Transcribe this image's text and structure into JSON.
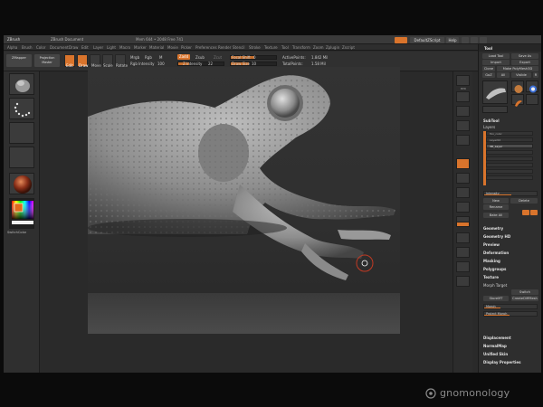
{
  "titlebar": {
    "app": "ZBrush",
    "doc": "ZBrush Document",
    "stats": "Mem 644 • 2048  Free 741",
    "default_zscript": "DefaultZScript",
    "help": "Help"
  },
  "menu": [
    "Alpha",
    "Brush",
    "Color",
    "Document",
    "Draw",
    "Edit",
    "Layer",
    "Light",
    "Macro",
    "Marker",
    "Material",
    "Movie",
    "Picker",
    "Preferences",
    "Render",
    "Stencil",
    "Stroke",
    "Texture",
    "Tool",
    "Transform",
    "Zoom",
    "Zplugin",
    "Zscript"
  ],
  "toolbar": {
    "zappend_label": "ZMapper",
    "projection_label": "Projection Master",
    "edit_label": "Edit",
    "draw_label": "Draw",
    "move_label": "Move",
    "scale_label": "Scale",
    "rotate_label": "Rotate",
    "mrgb_label": "Mrgb",
    "rgb_label": "Rgb",
    "m_label": "M",
    "rgb_intensity_label": "Rgb Intensity",
    "rgb_intensity_value": "100",
    "zadd_label": "Zadd",
    "zsub_label": "Zsub",
    "zcut_label": "Zcut",
    "z_intensity_label": "Z Intensity",
    "z_intensity_value": "22",
    "focal_shift_label": "Focal Shift",
    "focal_shift_value": "0",
    "draw_size_label": "Draw Size",
    "draw_size_value": "10",
    "active_points_label": "ActivePoints:",
    "active_points_value": "1.842 Mil",
    "total_points_label": "TotalPoints:",
    "total_points_value": "1.58 Mil"
  },
  "left_shelf": {
    "texture_label": "Texture",
    "material_label": "Material",
    "switch_color_label": "SwitchColor"
  },
  "right_shelf": {
    "items": [
      "BPR",
      "SPix",
      "Scroll",
      "Zoom",
      "Actual",
      "AAHalf",
      "Persp",
      "Floor",
      "Local",
      "XYZ",
      "Frame",
      "Move",
      "Scale",
      "Rotate",
      "PolyF",
      "Transp",
      "Ghost",
      "Solo"
    ]
  },
  "tool_panel": {
    "title": "Tool",
    "load_tool": "Load Tool",
    "save_as": "Save As",
    "import": "Import",
    "export": "Export",
    "clone": "Clone",
    "make_polymesh": "Make PolyMesh3D",
    "goz": "GoZ",
    "all": "All",
    "visible": "Visible",
    "r": "R",
    "subtool": "SubTool",
    "layers": "Layers",
    "layer_items": [
      "Tox_color",
      "Layer02",
      "3D_Layer"
    ],
    "intensity_label": "Intensity",
    "new": "New",
    "delete": "Delete",
    "rename": "Rename",
    "bake_all": "Bake All",
    "geometry": "Geometry",
    "geometry_hd": "Geometry HD",
    "preview": "Preview",
    "deformation": "Deformation",
    "masking": "Masking",
    "polygroups": "Polygroups",
    "texture": "Texture",
    "morph_target": "Morph Target",
    "switch": "Switch",
    "storemt": "StoreMT",
    "createdifft": "CreateDiffMesh",
    "morph": "Morph",
    "project_morph": "Project Morph",
    "displacement": "Displacement",
    "normalmap": "NormalMap",
    "unified_skin": "Unified Skin",
    "display_properties": "Display Properties"
  },
  "watermark": "gnomonology",
  "colors": {
    "accent": "#d9742c",
    "panel": "#2e2e2e",
    "canvas": "#333333"
  }
}
